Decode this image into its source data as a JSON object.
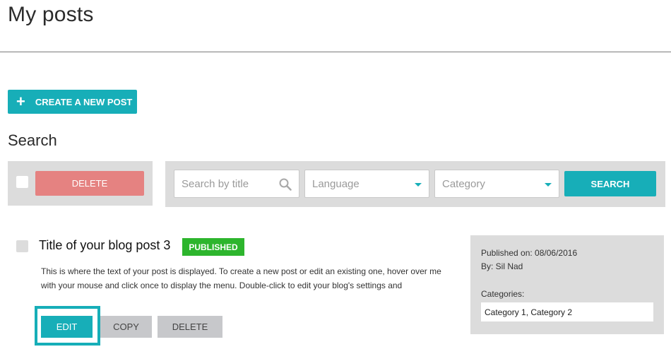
{
  "page": {
    "title": "My posts"
  },
  "toolbar": {
    "create_label": "CREATE A NEW POST",
    "create_icon": "plus-icon"
  },
  "search": {
    "heading": "Search",
    "bulk_delete_label": "DELETE",
    "title_placeholder": "Search by title",
    "language_placeholder": "Language",
    "category_placeholder": "Category",
    "search_label": "SEARCH"
  },
  "post": {
    "title": "Title of your blog post 3",
    "status": "PUBLISHED",
    "excerpt": "This is where the text of your post is displayed. To create a new post or edit an existing one, hover over me with your mouse and click once to display the menu. Double-click to edit your blog's settings and",
    "edit_label": "EDIT",
    "copy_label": "COPY",
    "delete_label": "DELETE",
    "published_on": "Published on: 08/06/2016",
    "author": "By: Sil Nad",
    "categories_label": "Categories:",
    "categories_value": "Category 1, Category 2"
  },
  "colors": {
    "accent": "#17aeb8",
    "danger": "#e58281",
    "published": "#2db52d",
    "panel": "#dcdcdc"
  }
}
